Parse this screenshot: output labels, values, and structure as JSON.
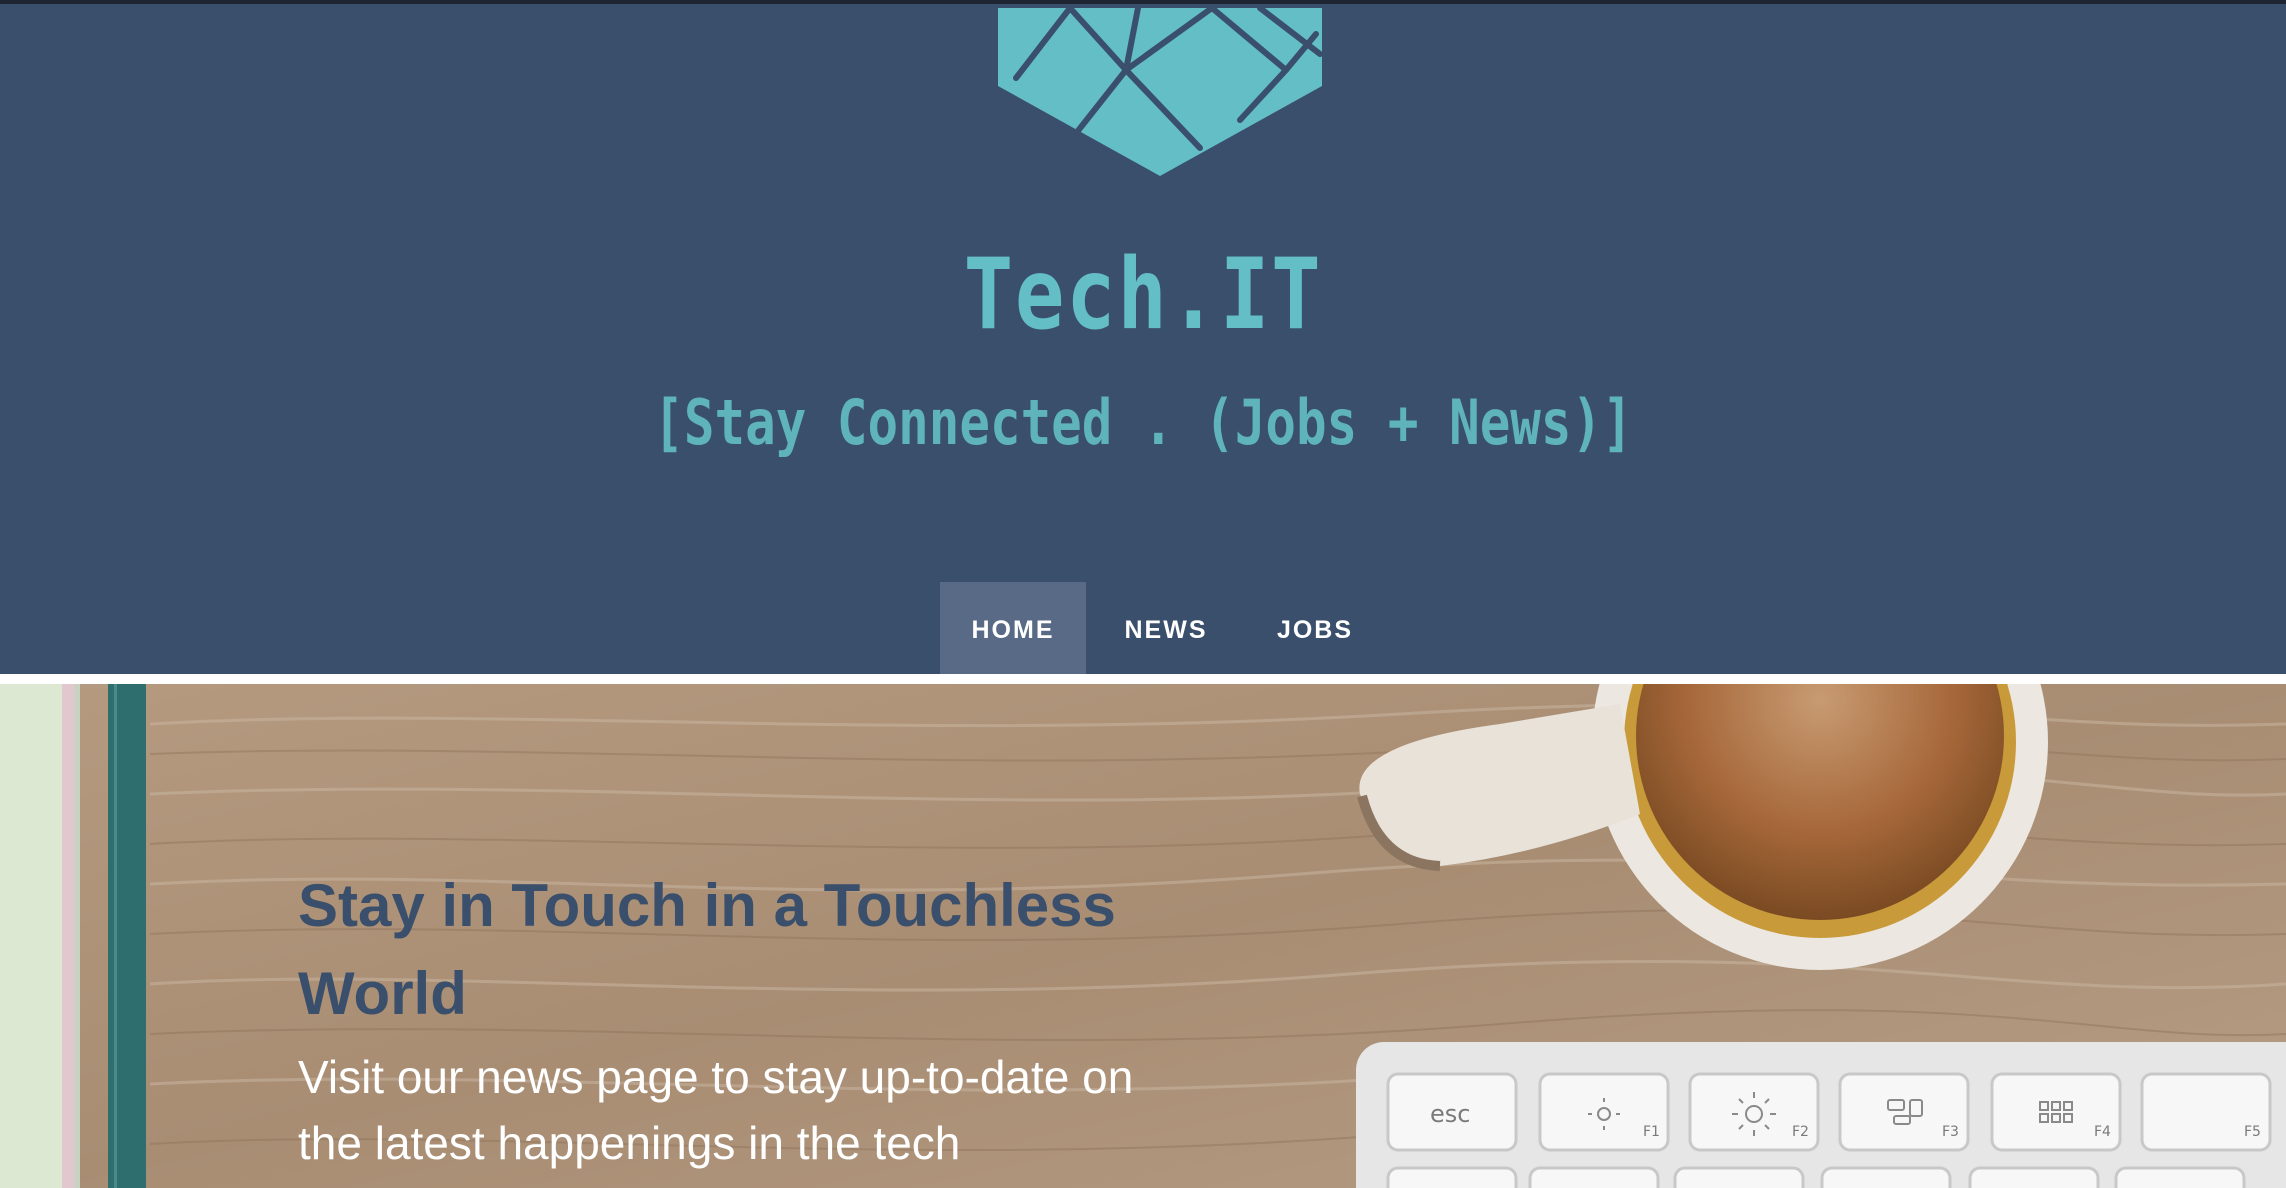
{
  "header": {
    "brand_title": "Tech.IT",
    "tagline": "[Stay Connected . (Jobs + News)]",
    "logo_icon": "hexagon-grid-icon"
  },
  "nav": {
    "items": [
      {
        "label": "HOME",
        "active": true
      },
      {
        "label": "NEWS",
        "active": false
      },
      {
        "label": "JOBS",
        "active": false
      }
    ]
  },
  "hero": {
    "heading": "Stay in Touch in a Touchless World",
    "body": "Visit our news page to stay up-to-date on the latest happenings in the tech",
    "keyboard_keys": {
      "esc": "esc",
      "f1": "F1",
      "f2": "F2",
      "f3": "F3",
      "f4": "F4",
      "f5": "F5"
    }
  },
  "colors": {
    "header_bg": "#3a4f6b",
    "brand_teal": "#63bec6",
    "nav_active_bg": "#586a86",
    "heading_navy": "#3a4f6b"
  }
}
